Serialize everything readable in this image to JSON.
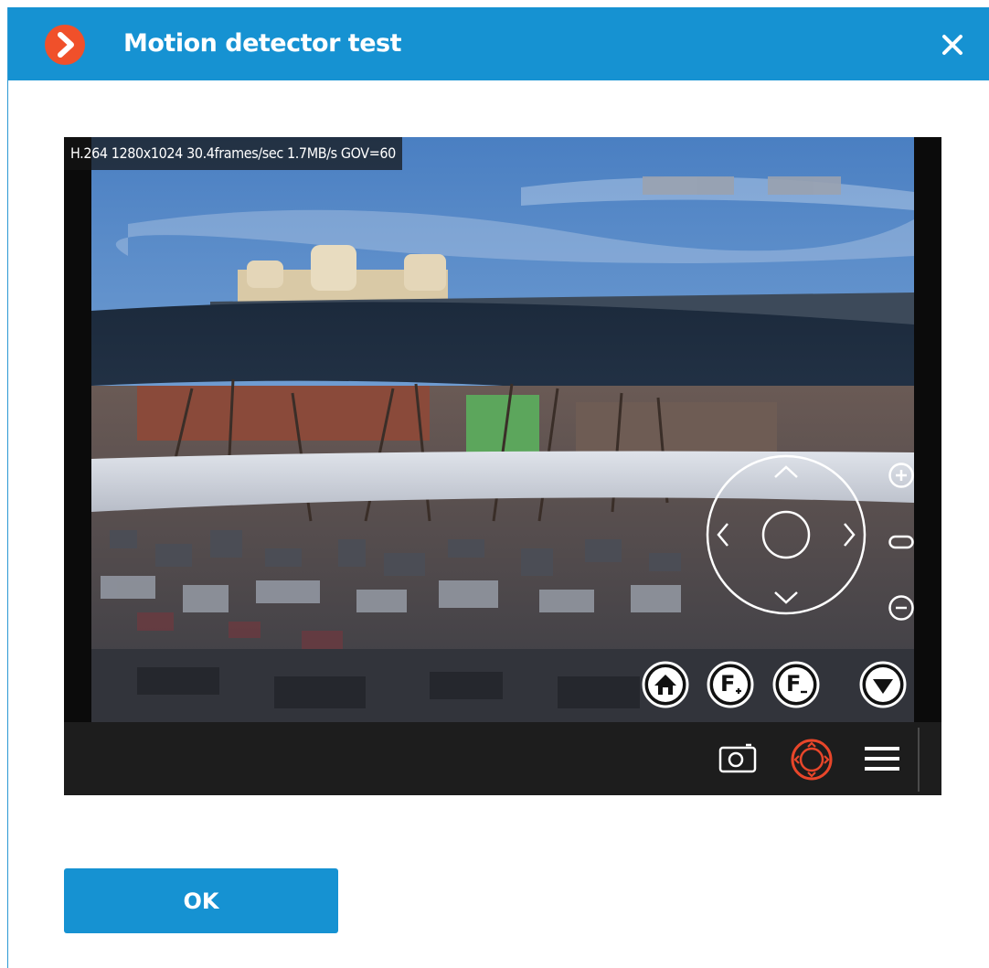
{
  "dialog": {
    "title": "Motion detector test",
    "logo_icon": "chevron-right-circle-icon",
    "close_icon": "close-icon",
    "accent_color": "#1692d2",
    "logo_color": "#f0502a"
  },
  "video": {
    "info_text": "H.264 1280x1024 30.4frames/sec 1.7MB/s GOV=60",
    "ptz_icons": [
      "arrow-up-icon",
      "arrow-down-icon",
      "arrow-left-icon",
      "arrow-right-icon",
      "ptz-center-icon",
      "zoom-in-icon",
      "zoom-reset-icon",
      "zoom-out-icon",
      "home-icon",
      "focus-plus-icon",
      "focus-minus-icon",
      "collapse-icon"
    ],
    "focus_plus_label": "F",
    "focus_minus_label": "F"
  },
  "toolbar": {
    "icons": [
      "snapshot-camera-icon",
      "ptz-control-icon",
      "menu-icon"
    ],
    "active_color": "#e8462a"
  },
  "footer": {
    "ok_label": "OK"
  }
}
